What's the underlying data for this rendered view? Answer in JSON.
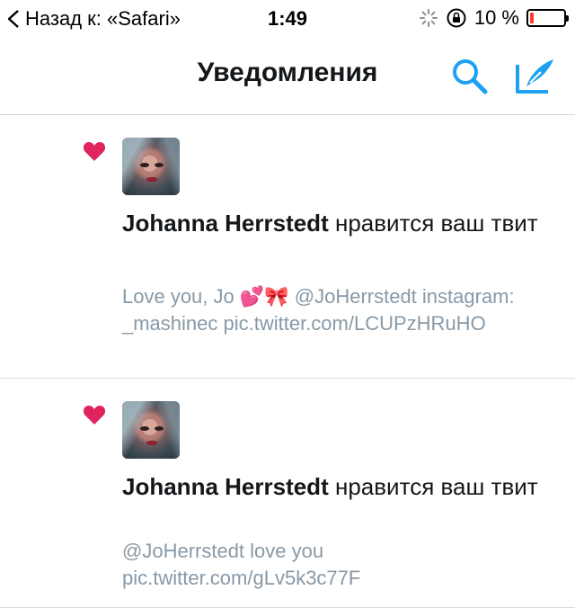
{
  "status_bar": {
    "back_label": "Назад к: «Safari»",
    "time": "1:49",
    "battery_percent": "10 %",
    "battery_level": 0.1,
    "battery_color": "#ff3b30"
  },
  "nav": {
    "title": "Уведомления",
    "search_icon": "search-icon",
    "compose_icon": "compose-tweet-icon",
    "accent_color": "#1da1f2"
  },
  "notifications": [
    {
      "icon": "heart-icon",
      "user_name": "Johanna Herrstedt",
      "action": " нравится ваш твит",
      "tweet_text": "Love you, Jo 💕🎀 @JoHerrstedt instagram:  _mashinec pic.twitter.com/LCUPzHRuHO"
    },
    {
      "icon": "heart-icon",
      "user_name": "Johanna Herrstedt",
      "action": " нравится ваш твит",
      "tweet_text": "@JoHerrstedt love you pic.twitter.com/gLv5k3c77F"
    }
  ]
}
